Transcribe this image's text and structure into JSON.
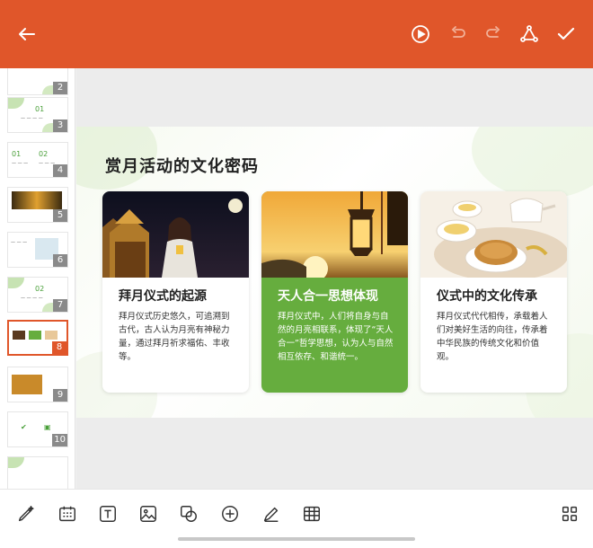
{
  "colors": {
    "accent": "#e0562a",
    "green": "#66ad3e"
  },
  "topbar": {
    "icons": [
      "back-arrow-icon",
      "play-icon",
      "undo-icon",
      "redo-icon",
      "share-icon",
      "check-icon"
    ]
  },
  "sidebar": {
    "slides": [
      {
        "num": "2"
      },
      {
        "num": "3"
      },
      {
        "num": "4"
      },
      {
        "num": "5"
      },
      {
        "num": "6"
      },
      {
        "num": "7"
      },
      {
        "num": "8"
      },
      {
        "num": "9"
      },
      {
        "num": "10"
      }
    ],
    "add_label": "+"
  },
  "slide": {
    "title": "赏月活动的文化密码",
    "cards": [
      {
        "title": "拜月仪式的起源",
        "text": "拜月仪式历史悠久，可追溯到古代，古人认为月亮有神秘力量，通过拜月祈求福佑、丰收等。"
      },
      {
        "title": "天人合一思想体现",
        "text": "拜月仪式中，人们将自身与自然的月亮相联系，体现了“天人合一”哲学思想，认为人与自然相互依存、和谐统一。"
      },
      {
        "title": "仪式中的文化传承",
        "text": "拜月仪式代代相传，承载着人们对美好生活的向往，传承着中华民族的传统文化和价值观。"
      }
    ]
  },
  "bottombar": {
    "icons": [
      "pen-sparkle-icon",
      "slide-layout-icon",
      "text-box-icon",
      "image-icon",
      "shapes-icon",
      "add-circle-icon",
      "pencil-icon",
      "table-icon",
      "grid-view-icon"
    ]
  }
}
